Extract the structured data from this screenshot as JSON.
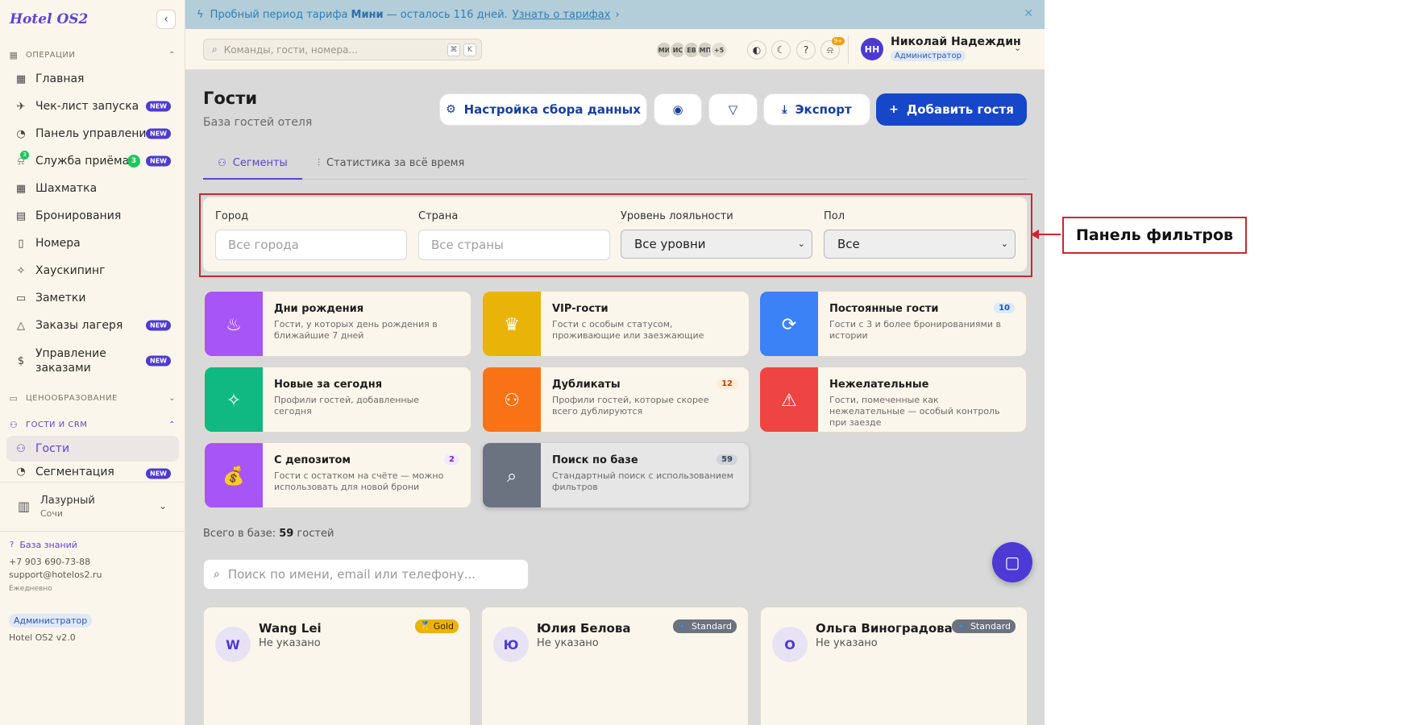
{
  "sidebar": {
    "brand": "Hotel OS2",
    "sections": {
      "ops": "ОПЕРАЦИИ",
      "pricing": "ЦЕНООБРАЗОВАНИЕ",
      "crm": "ГОСТИ И CRM"
    },
    "items": [
      {
        "label": "Главная",
        "icon": "home-icon"
      },
      {
        "label": "Чек-лист запуска",
        "icon": "rocket-icon",
        "badge": "NEW"
      },
      {
        "label": "Панель управления",
        "icon": "gauge-icon",
        "badge": "NEW"
      },
      {
        "label": "Служба приёма",
        "icon": "bell-icon",
        "badge": "NEW",
        "count": "3",
        "dot": "3"
      },
      {
        "label": "Шахматка",
        "icon": "grid-icon"
      },
      {
        "label": "Бронирования",
        "icon": "clipboard-icon"
      },
      {
        "label": "Номера",
        "icon": "door-icon"
      },
      {
        "label": "Хаускипинг",
        "icon": "sparkle-icon"
      },
      {
        "label": "Заметки",
        "icon": "note-icon"
      },
      {
        "label": "Заказы лагеря",
        "icon": "tent-icon",
        "badge": "NEW"
      },
      {
        "label": "Управление заказами",
        "icon": "dollar-icon",
        "badge": "NEW"
      },
      {
        "label": "Гости",
        "icon": "users-icon"
      },
      {
        "label": "Сегментация",
        "icon": "pie-icon",
        "badge": "NEW"
      }
    ],
    "hotel": {
      "name": "Лазурный",
      "city": "Сочи"
    },
    "kb": "База знаний",
    "phone": "+7 903 690-73-88",
    "email": "support@hotelos2.ru",
    "schedule": "Ежедневно",
    "role": "Администратор",
    "version": "Hotel OS2 v2.0"
  },
  "trial": {
    "text1": "Пробный период тарифа",
    "plan": "Мини",
    "text2": "— осталось 116 дней.",
    "link": "Узнать о тарифах"
  },
  "topbar": {
    "search_placeholder": "Команды, гости, номера...",
    "kbd1": "⌘",
    "kbd2": "K",
    "avatars": [
      "МИ",
      "ИС",
      "ЕВ",
      "МП",
      "+5"
    ],
    "notif_count": "9+",
    "user_initials": "НН",
    "user_name": "Николай Надеждин",
    "user_role": "Администратор"
  },
  "page": {
    "title": "Гости",
    "subtitle": "База гостей отеля",
    "btn_settings": "Настройка сбора данных",
    "btn_export": "Экспорт",
    "btn_add": "Добавить гостя",
    "tab_segments": "Сегменты",
    "tab_stats": "Статистика за всё время"
  },
  "filters": {
    "city_label": "Город",
    "city_placeholder": "Все города",
    "country_label": "Страна",
    "country_placeholder": "Все страны",
    "loyalty_label": "Уровень лояльности",
    "loyalty_value": "Все уровни",
    "gender_label": "Пол",
    "gender_value": "Все"
  },
  "segments": [
    {
      "title": "Дни рождения",
      "desc": "Гости, у которых день рождения в ближайшие 7 дней",
      "color": "#a855f7",
      "icon": "cake-icon"
    },
    {
      "title": "VIP-гости",
      "desc": "Гости с особым статусом, проживающие или заезжающие",
      "color": "#eab308",
      "icon": "crown-icon"
    },
    {
      "title": "Постоянные гости",
      "desc": "Гости с 3 и более бронированиями в истории",
      "color": "#3b82f6",
      "icon": "refresh-icon",
      "count": "10"
    },
    {
      "title": "Новые за сегодня",
      "desc": "Профили гостей, добавленные сегодня",
      "color": "#10b981",
      "icon": "sparkle-icon"
    },
    {
      "title": "Дубликаты",
      "desc": "Профили гостей, которые скорее всего дублируются",
      "color": "#f97316",
      "icon": "users-icon",
      "count": "12"
    },
    {
      "title": "Нежелательные",
      "desc": "Гости, помеченные как нежелательные — особый контроль при заезде",
      "color": "#ef4444",
      "icon": "warning-icon"
    },
    {
      "title": "С депозитом",
      "desc": "Гости с остатком на счёте — можно использовать для новой брони",
      "color": "#a855f7",
      "icon": "money-bag-icon",
      "count": "2"
    },
    {
      "title": "Поиск по базе",
      "desc": "Стандартный поиск с использованием фильтров",
      "color": "#6b7280",
      "icon": "search-icon",
      "count": "59"
    }
  ],
  "total": {
    "label": "Всего в базе:",
    "count": "59",
    "suffix": "гостей"
  },
  "guest_search_placeholder": "Поиск по имени, email или телефону...",
  "guests": [
    {
      "initial": "W",
      "name": "Wang Lei",
      "sub": "Не указано",
      "badge": "🥇 Gold"
    },
    {
      "initial": "Ю",
      "name": "Юлия Белова",
      "sub": "Не указано",
      "badge": "🔹 Standard"
    },
    {
      "initial": "О",
      "name": "Ольга Виноградова",
      "sub": "Не указано",
      "badge": "🔹 Standard"
    }
  ],
  "annotation": "Панель фильтров"
}
